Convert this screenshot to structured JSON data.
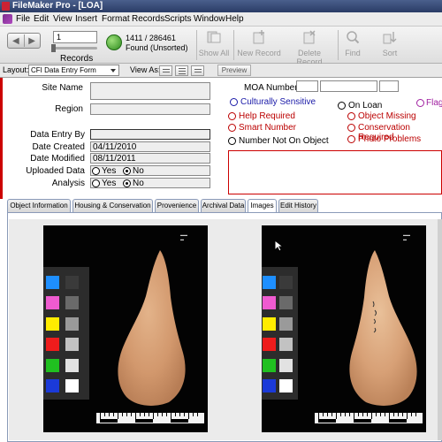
{
  "window": {
    "title": "FileMaker Pro - [LOA]"
  },
  "menu": [
    "File",
    "Edit",
    "View",
    "Insert",
    "Format",
    "Records",
    "Scripts",
    "Window",
    "Help"
  ],
  "toolbar": {
    "record_input": "1",
    "records_label": "Records",
    "count": "1411 / 286461",
    "found": "Found (Unsorted)",
    "buttons": [
      "Show All",
      "New Record",
      "Delete Record",
      "Find",
      "Sort"
    ]
  },
  "layoutbar": {
    "layout_label": "Layout:",
    "layout_value": "CFI Data Entry Form",
    "view_as": "View As:",
    "preview": "Preview"
  },
  "form": {
    "site_name_label": "Site Name",
    "region_label": "Region",
    "data_entry_by_label": "Data Entry By",
    "date_created_label": "Date Created",
    "date_created": "04/11/2010",
    "date_modified_label": "Date Modified",
    "date_modified": "08/11/2011",
    "uploaded_data_label": "Uploaded Data",
    "analysis_label": "Analysis",
    "yes": "Yes",
    "no": "No",
    "moa_label": "MOA Number",
    "culturally_sensitive": "Culturally Sensitive",
    "on_loan": "On Loan",
    "flag": "Flag",
    "help_required": "Help Required",
    "object_missing": "Object Missing",
    "smart_number": "Smart Number",
    "conservation_required": "Conservation Required",
    "number_not_on_object": "Number Not On Object",
    "photo_problems": "Photo Problems"
  },
  "tabs": [
    "Object Information",
    "Housing & Conservation",
    "Provenience",
    "Archival Data",
    "Images",
    "Edit History"
  ],
  "active_tab": "Images",
  "colors": {
    "accent_red": "#b00000",
    "accent_blue": "#1a1aa8",
    "accent_purple": "#a020a0",
    "title_bar": "#2a3c66"
  },
  "swatches": [
    "#1e8fff",
    "#ef5bd0",
    "#ffec00",
    "#ee1c1c",
    "#20c020",
    "#1b3ad8"
  ],
  "grays": [
    "#3a3a3a",
    "#6a6a6a",
    "#9a9a9a",
    "#c2c2c2",
    "#e2e2e2",
    "#ffffff"
  ]
}
